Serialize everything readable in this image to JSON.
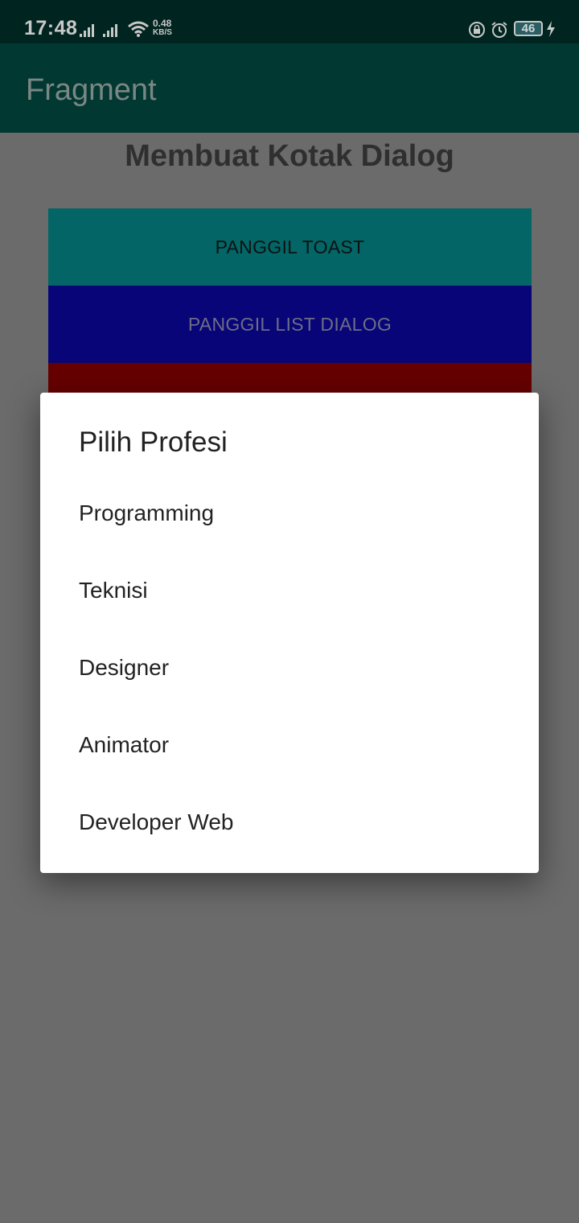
{
  "status_bar": {
    "time": "17:48",
    "net_speed_value": "0.48",
    "net_speed_unit": "KB/S",
    "battery": "46",
    "icons": [
      "signal-icon",
      "signal-icon",
      "wifi-icon",
      "screen-rotation-lock-icon",
      "alarm-icon",
      "battery-icon",
      "charging-icon"
    ]
  },
  "app_bar": {
    "title": "Fragment"
  },
  "main": {
    "heading": "Membuat Kotak Dialog",
    "buttons": [
      {
        "label": "PANGGIL TOAST",
        "color": "#036566"
      },
      {
        "label": "PANGGIL LIST DIALOG",
        "color": "#070578"
      },
      {
        "label": "",
        "color": "#660000"
      }
    ]
  },
  "dialog": {
    "title": "Pilih Profesi",
    "items": [
      "Programming",
      "Teknisi",
      "Designer",
      "Animator",
      "Developer Web"
    ]
  },
  "colors": {
    "status_bar": "#00241f",
    "app_bar": "#023832",
    "scrim_background": "#6b6b6b",
    "dialog_background": "#ffffff"
  }
}
